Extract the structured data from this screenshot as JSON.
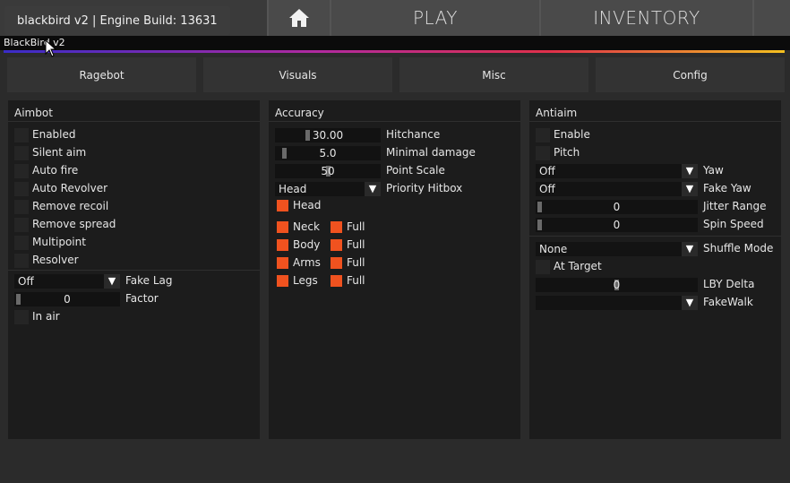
{
  "topbar": {
    "play": "PLAY",
    "inventory": "INVENTORY",
    "home_icon": "home-icon"
  },
  "watermark": "blackbird v2 | Engine Build: 13631",
  "menu": {
    "title": "BlackBird v2",
    "tabs": [
      "Ragebot",
      "Visuals",
      "Misc",
      "Config"
    ],
    "accent_gradient": [
      "#3a2cc8",
      "#b02aa0",
      "#e0304a",
      "#f4c020"
    ]
  },
  "aimbot": {
    "title": "Aimbot",
    "checkboxes": [
      "Enabled",
      "Silent aim",
      "Auto fire",
      "Auto Revolver",
      "Remove recoil",
      "Remove spread",
      "Multipoint",
      "Resolver"
    ],
    "fakelag_select": "Off",
    "fakelag_label": "Fake Lag",
    "factor_value": "0",
    "factor_label": "Factor",
    "inair_label": "In air"
  },
  "accuracy": {
    "title": "Accuracy",
    "hitchance_value": "30.00",
    "hitchance_label": "Hitchance",
    "mindamage_value": "5.0",
    "mindamage_label": "Minimal damage",
    "pointscale_value": "50",
    "pointscale_label": "Point Scale",
    "priority_select": "Head",
    "priority_label": "Priority Hitbox",
    "head_label": "Head",
    "hitboxes": [
      "Neck",
      "Body",
      "Arms",
      "Legs"
    ],
    "full_label": "Full"
  },
  "antiaim": {
    "title": "Antiaim",
    "enable_label": "Enable",
    "pitch_label": "Pitch",
    "yaw_select": "Off",
    "yaw_label": "Yaw",
    "fakeyaw_select": "Off",
    "fakeyaw_label": "Fake Yaw",
    "jitter_value": "0",
    "jitter_label": "Jitter Range",
    "spin_value": "0",
    "spin_label": "Spin Speed",
    "shuffle_select": "None",
    "shuffle_label": "Shuffle Mode",
    "attarget_label": "At Target",
    "lby_value": "0",
    "lby_label": "LBY Delta",
    "fakewalk_select": "",
    "fakewalk_label": "FakeWalk"
  },
  "colors": {
    "checked": "#f0521f",
    "panel": "#1c1c1c",
    "background": "#2b2b2b"
  }
}
